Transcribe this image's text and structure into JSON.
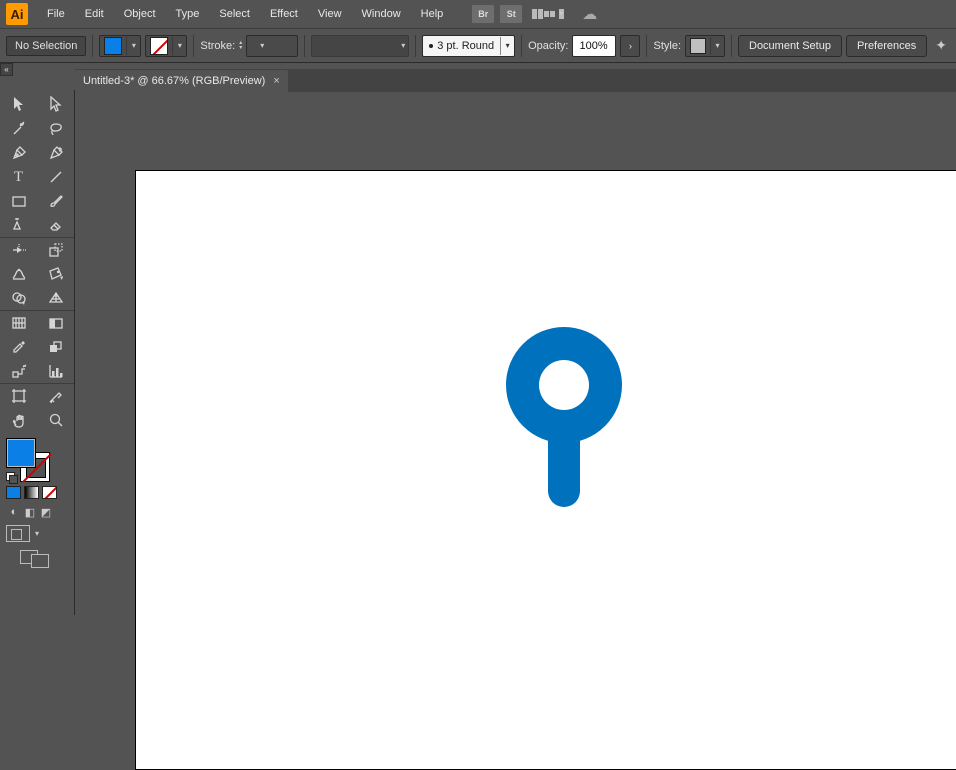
{
  "app": {
    "name": "Ai"
  },
  "menu": {
    "file": "File",
    "edit": "Edit",
    "object": "Object",
    "type": "Type",
    "select": "Select",
    "effect": "Effect",
    "view": "View",
    "window": "Window",
    "help": "Help",
    "br": "Br",
    "st": "St"
  },
  "ctrl": {
    "no_selection": "No Selection",
    "stroke_label": "Stroke:",
    "stroke_weight": "",
    "brush_profile": "",
    "round_label": "3 pt. Round",
    "opacity_label": "Opacity:",
    "opacity_value": "100%",
    "style_label": "Style:",
    "doc_setup": "Document Setup",
    "prefs": "Preferences"
  },
  "tab": {
    "title": "Untitled-3* @ 66.67% (RGB/Preview)"
  },
  "colors": {
    "fill": "#0a7fe5",
    "stroke": "none",
    "shape": "#0071bc"
  }
}
